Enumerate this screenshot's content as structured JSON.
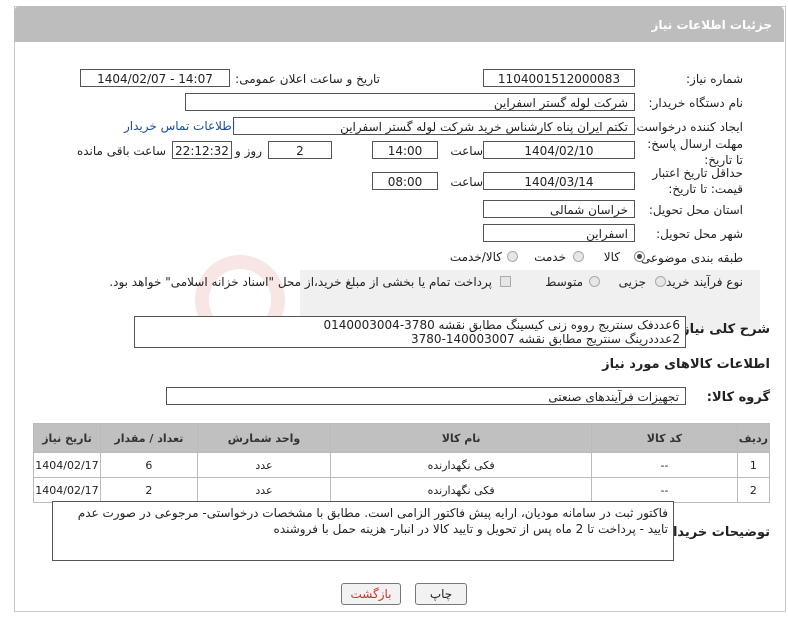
{
  "header": {
    "title": "جزئیات اطلاعات نیاز"
  },
  "fields": {
    "need_number_label": "شماره نیاز:",
    "need_number": "1104001512000083",
    "announce_label": "تاریخ و ساعت اعلان عمومی:",
    "announce_value": "1404/02/07 - 14:07",
    "buyer_org_label": "نام دستگاه خریدار:",
    "buyer_org": "شرکت لوله گستر اسفراین",
    "creator_label": "ایجاد کننده درخواست:",
    "creator": "تکتم ایران پناه کارشناس خرید شرکت لوله گستر اسفراین",
    "contact_link": "اطلاعات تماس خریدار",
    "deadline_label": "مهلت ارسال پاسخ: تا تاریخ:",
    "deadline_date": "1404/02/10",
    "time_word": "ساعت",
    "deadline_time": "14:00",
    "days_value": "2",
    "days_word": "روز و",
    "remaining_time": "22:12:32",
    "remaining_word": "ساعت باقی مانده",
    "validity_label": "حداقل تاریخ اعتبار قیمت: تا تاریخ:",
    "validity_date": "1404/03/14",
    "validity_time": "08:00",
    "province_label": "استان محل تحویل:",
    "province": "خراسان شمالی",
    "city_label": "شهر محل تحویل:",
    "city": "اسفراین",
    "category_label": "طبقه بندی موضوعی:",
    "category_options": [
      "کالا",
      "خدمت",
      "کالا/خدمت"
    ],
    "process_label": "نوع فرآیند خرید :",
    "process_options": [
      "جزیی",
      "متوسط"
    ],
    "payment_note": "پرداخت تمام یا بخشی از مبلغ خرید،از محل \"اسناد خزانه اسلامی\" خواهد بود."
  },
  "description": {
    "label": "شرح کلی نیاز:",
    "line1": "6عددفک سنتریج رووه زنی کیسینگ مطابق نقشه 3780-0140003004",
    "line2": "2عدددرینگ سنتریج مطابق نقشه 140003007-3780"
  },
  "goods_section": {
    "title": "اطلاعات کالاهای مورد نیاز",
    "group_label": "گروه کالا:",
    "group_value": "تجهیزات فرآیندهای صنعتی"
  },
  "table": {
    "headers": [
      "ردیف",
      "کد کالا",
      "نام کالا",
      "واحد شمارش",
      "تعداد / مقدار",
      "تاریخ نیاز"
    ],
    "rows": [
      [
        "1",
        "--",
        "فکی نگهدارنده",
        "عدد",
        "6",
        "1404/02/17"
      ],
      [
        "2",
        "--",
        "فکی نگهدارنده",
        "عدد",
        "2",
        "1404/02/17"
      ]
    ]
  },
  "buyer_notes": {
    "label": "توضیحات خریدار:",
    "text": "فاکتور ثبت در سامانه مودیان، ارایه پیش فاکتور الزامی است. مطابق با مشخصات درخواستی- مرجوعی در صورت عدم تایید - پرداخت تا 2 ماه پس از تحویل و تایید کالا در انبار- هزینه حمل با فروشنده"
  },
  "buttons": {
    "print": "چاپ",
    "back": "بازگشت"
  },
  "colors": {
    "header_bg": "#bdbdbd",
    "link": "#1a4fa0",
    "back_text": "#c0392b"
  }
}
